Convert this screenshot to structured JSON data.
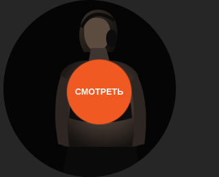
{
  "video": {
    "play_label": "СМОТРЕТЬ",
    "accent_color": "#f05a22",
    "background_color": "#050505",
    "frame_color": "#262626"
  }
}
